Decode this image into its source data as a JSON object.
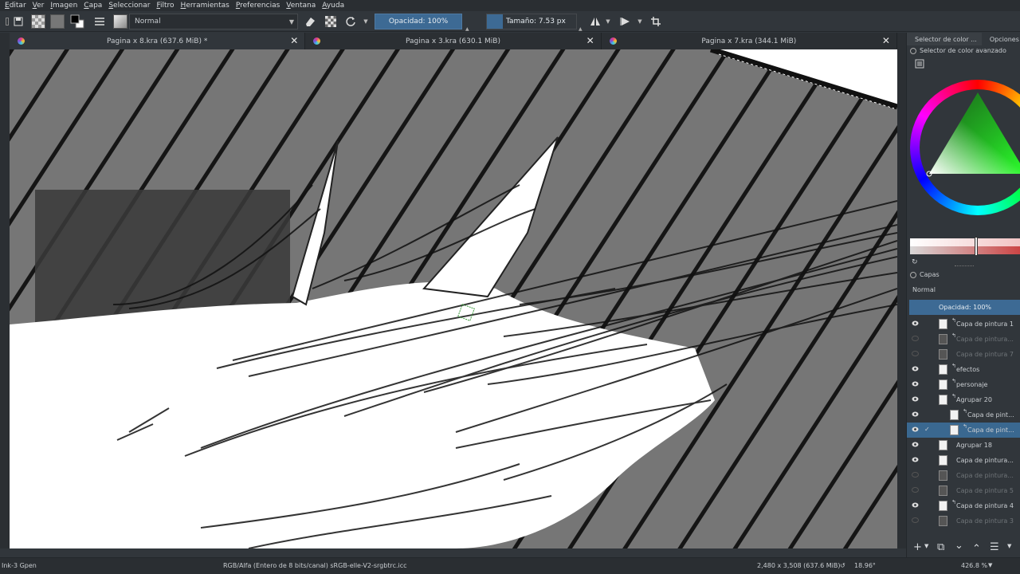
{
  "menu": [
    "Editar",
    "Ver",
    "Imagen",
    "Capa",
    "Seleccionar",
    "Filtro",
    "Herramientas",
    "Preferencias",
    "Ventana",
    "Ayuda"
  ],
  "toolbar": {
    "blend_mode": "Normal",
    "opacity": "Opacidad: 100%",
    "size": "Tamaño: 7.53 px"
  },
  "tabs": [
    {
      "label": "Pagina x 8.kra (637.6 MiB) *"
    },
    {
      "label": "Pagina x 3.kra (630.1 MiB)"
    },
    {
      "label": "Pagina x 7.kra (344.1 MiB)"
    }
  ],
  "dock": {
    "tab_color": "Selector de color ...",
    "tab_options": "Opciones d",
    "color_panel_title": "Selector de color avanzado",
    "layers_title": "Capas",
    "layers_blend": "Normal",
    "layers_opacity": "Opacidad:  100%"
  },
  "layers": [
    {
      "name": "Capa de pintura 1",
      "visible": true,
      "dim": false,
      "group": true
    },
    {
      "name": "Capa de pintura...",
      "visible": false,
      "dim": true,
      "group": true
    },
    {
      "name": "Capa de pintura 7",
      "visible": false,
      "dim": true,
      "group": false
    },
    {
      "name": "efectos",
      "visible": true,
      "dim": false,
      "group": true
    },
    {
      "name": "personaje",
      "visible": true,
      "dim": false,
      "group": true
    },
    {
      "name": "Agrupar 20",
      "visible": true,
      "dim": false,
      "group": true
    },
    {
      "name": "Capa de pint...",
      "visible": true,
      "dim": false,
      "group": true
    },
    {
      "name": "Capa de pint...",
      "visible": true,
      "dim": false,
      "group": true,
      "selected": true
    },
    {
      "name": "Agrupar 18",
      "visible": true,
      "dim": false,
      "group": false
    },
    {
      "name": "Capa de pintura...",
      "visible": true,
      "dim": false,
      "group": false
    },
    {
      "name": "Capa de pintura...",
      "visible": false,
      "dim": true,
      "group": false
    },
    {
      "name": "Capa de pintura 5",
      "visible": false,
      "dim": true,
      "group": false
    },
    {
      "name": "Capa de pintura 4",
      "visible": true,
      "dim": false,
      "group": true
    },
    {
      "name": "Capa de pintura 3",
      "visible": false,
      "dim": true,
      "group": false
    }
  ],
  "status": {
    "brush": "Ink-3 Gpen",
    "color_space": "RGB/Alfa (Entero de 8 bits/canal)  sRGB-elle-V2-srgbtrc.icc",
    "dimensions": "2,480 x 3,508 (637.6 MiB)",
    "rotation": "18.96°",
    "zoom": "426.8 %"
  }
}
